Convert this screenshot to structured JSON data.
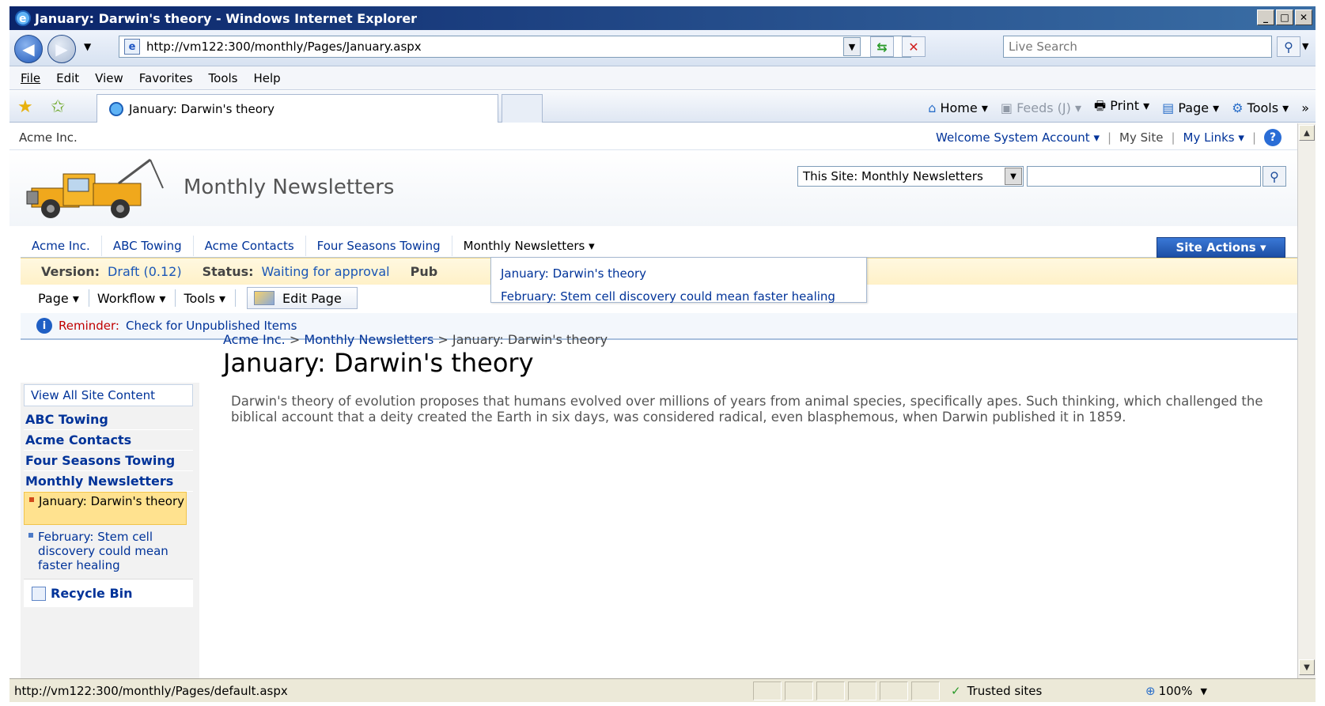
{
  "window": {
    "title": "January: Darwin's theory - Windows Internet Explorer",
    "minimize": "_",
    "maximize": "□",
    "close": "✕"
  },
  "address": {
    "url": "http://vm122:300/monthly/Pages/January.aspx",
    "search_placeholder": "Live Search"
  },
  "menu": {
    "file": "File",
    "edit": "Edit",
    "view": "View",
    "favorites": "Favorites",
    "tools": "Tools",
    "help": "Help"
  },
  "tabs": {
    "active_title": "January: Darwin's theory"
  },
  "commandbar": {
    "home": "Home",
    "feeds": "Feeds (J)",
    "print": "Print",
    "page": "Page",
    "tools": "Tools"
  },
  "site": {
    "brand": "Acme Inc.",
    "welcome": "Welcome System Account",
    "my_site": "My Site",
    "my_links": "My Links",
    "title": "Monthly Newsletters",
    "search_scope": "This Site: Monthly Newsletters",
    "site_actions": "Site Actions"
  },
  "topnav": [
    "Acme Inc.",
    "ABC Towing",
    "Acme Contacts",
    "Four Seasons Towing",
    "Monthly Newsletters"
  ],
  "flyout": [
    "January: Darwin's theory",
    "February: Stem cell discovery could mean faster healing"
  ],
  "pagestatus": {
    "version_label": "Version:",
    "version_value": "Draft (0.12)",
    "status_label": "Status:",
    "status_value": "Waiting for approval",
    "pub_label": "Pub"
  },
  "editbar": {
    "page": "Page",
    "workflow": "Workflow",
    "tools": "Tools",
    "edit_page": "Edit Page"
  },
  "reminder": {
    "label": "Reminder:",
    "link": "Check for Unpublished Items"
  },
  "breadcrumb": {
    "root": "Acme Inc.",
    "sep": ">",
    "section": "Monthly Newsletters",
    "current": "January: Darwin's theory"
  },
  "page": {
    "title": "January: Darwin's theory",
    "body": "Darwin's theory of evolution proposes that humans evolved over millions of years from animal species, specifically apes. Such thinking, which challenged the biblical account that a deity created the Earth in six days, was considered radical, even blasphemous, when Darwin published it in 1859."
  },
  "quicklaunch": {
    "view_all": "View All Site Content",
    "headings": [
      "ABC Towing",
      "Acme Contacts",
      "Four Seasons Towing",
      "Monthly Newsletters"
    ],
    "items": [
      "January: Darwin's theory",
      "February: Stem cell discovery could mean faster healing"
    ],
    "recycle_bin": "Recycle Bin"
  },
  "statusbar": {
    "url": "http://vm122:300/monthly/Pages/default.aspx",
    "zone": "Trusted sites",
    "zoom": "100%"
  }
}
